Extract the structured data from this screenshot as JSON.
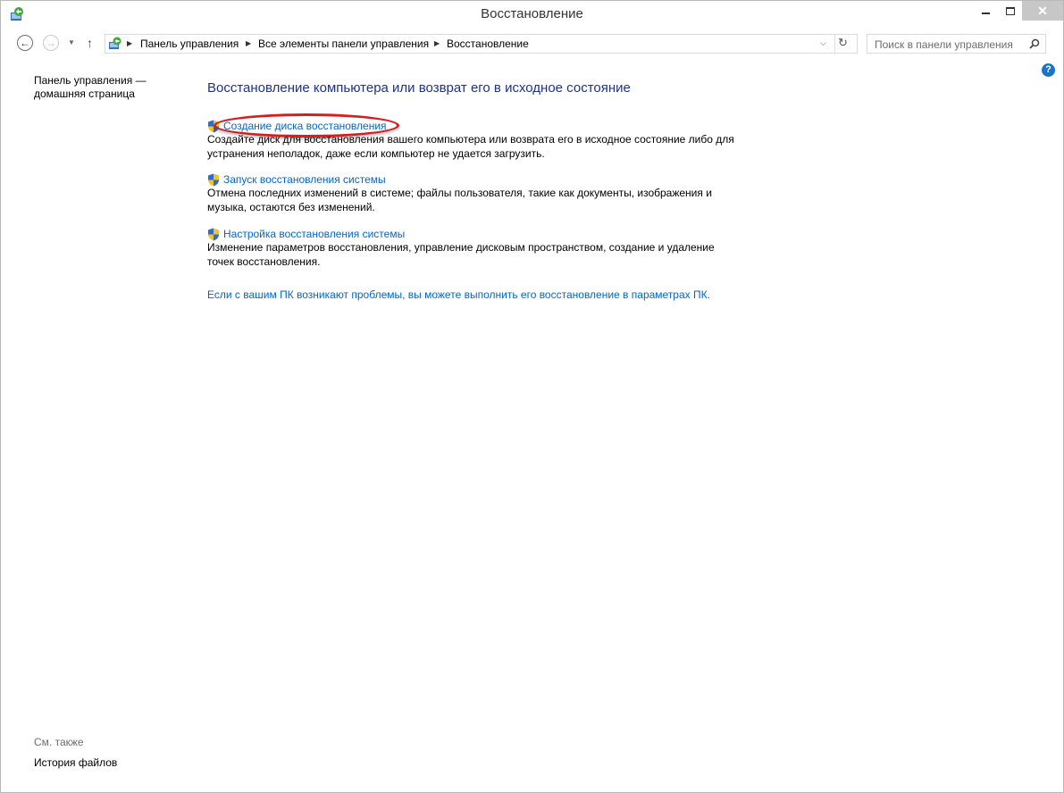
{
  "window": {
    "title": "Восстановление"
  },
  "nav": {
    "back_icon": "back-arrow-icon",
    "forward_icon": "forward-arrow-icon",
    "up_icon": "up-arrow-icon",
    "breadcrumbs": [
      "Панель управления",
      "Все элементы панели управления",
      "Восстановление"
    ],
    "search_placeholder": "Поиск в панели управления"
  },
  "left_pane": {
    "home_link": "Панель управления — домашняя страница",
    "see_also_label": "См. также",
    "see_also_items": [
      "История файлов"
    ]
  },
  "main": {
    "heading": "Восстановление компьютера или возврат его в исходное состояние",
    "tasks": [
      {
        "link": "Создание диска восстановления",
        "description": "Создайте диск для восстановления вашего компьютера или возврата его в исходное состояние либо для устранения неполадок, даже если компьютер не удается загрузить.",
        "highlighted": true
      },
      {
        "link": "Запуск восстановления системы",
        "description": "Отмена последних изменений в системе; файлы пользователя, такие как документы, изображения и музыка, остаются без изменений."
      },
      {
        "link": "Настройка восстановления системы",
        "description": "Изменение параметров восстановления, управление дисковым пространством, создание и удаление точек восстановления."
      }
    ],
    "bottom_link": "Если с вашим ПК возникают проблемы, вы можете выполнить его восстановление в параметрах ПК."
  },
  "colors": {
    "link": "#0066cc",
    "heading": "#1e3287",
    "annotation": "#d21f1f"
  }
}
